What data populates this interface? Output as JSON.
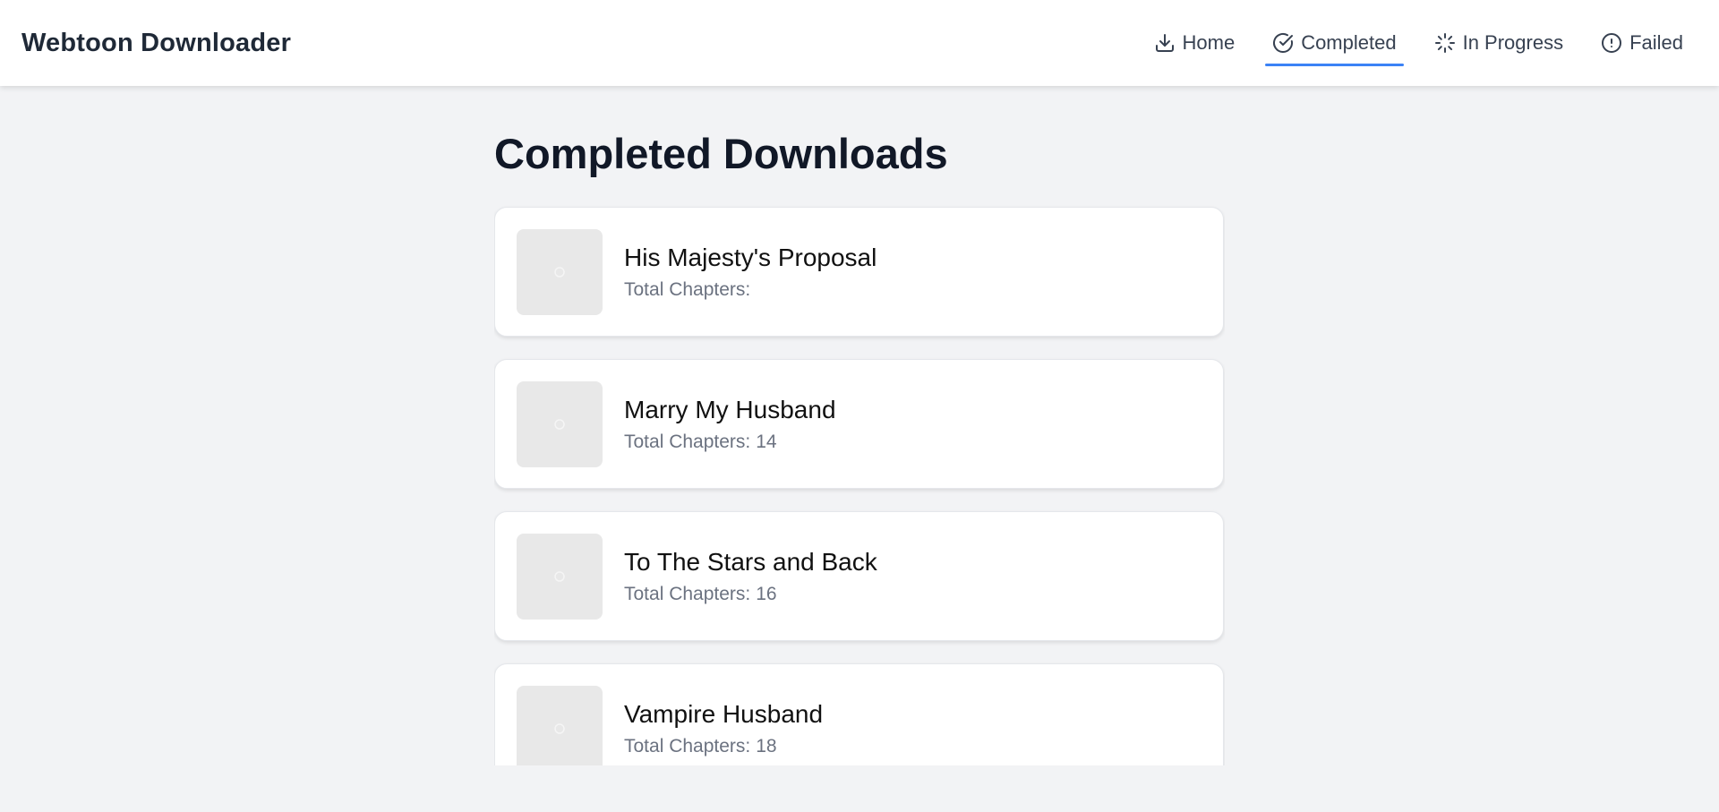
{
  "app": {
    "title": "Webtoon Downloader"
  },
  "nav": {
    "items": [
      {
        "label": "Home",
        "icon": "download-icon"
      },
      {
        "label": "Completed",
        "icon": "check-circle-icon",
        "active": true
      },
      {
        "label": "In Progress",
        "icon": "loader-icon"
      },
      {
        "label": "Failed",
        "icon": "alert-circle-icon"
      }
    ]
  },
  "main": {
    "title": "Completed Downloads",
    "chapters_label": "Total Chapters:",
    "items": [
      {
        "title": "His Majesty's Proposal",
        "chapters": ""
      },
      {
        "title": "Marry My Husband",
        "chapters": "14"
      },
      {
        "title": "To The Stars and Back",
        "chapters": "16"
      },
      {
        "title": "Vampire Husband",
        "chapters": "18"
      }
    ]
  },
  "colors": {
    "accent": "#3b82f6",
    "background": "#f2f3f5",
    "card": "#ffffff",
    "thumbnail": "#e8e8e8"
  }
}
